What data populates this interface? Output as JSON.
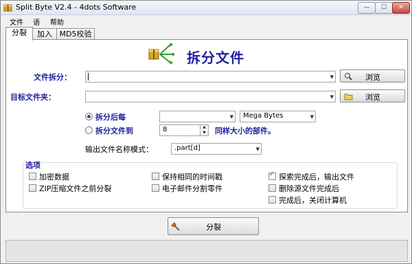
{
  "window": {
    "title": "Split Byte V2.4 - 4dots Software",
    "min_glyph": "—",
    "max_glyph": "☐",
    "close_glyph": "✕",
    "close_color": "#c9463d"
  },
  "menu": [
    "文件",
    "语",
    "帮助"
  ],
  "tabs": [
    "分裂",
    "加入",
    "MD5校验"
  ],
  "main": {
    "heading": "拆分文件",
    "file_label": "文件拆分：",
    "file_value": "",
    "browse_label_1": "浏览",
    "target_label": "目标文件夹：",
    "target_value": "",
    "browse_label_2": "浏览",
    "split_each_label": "拆分后每",
    "split_each_value": "",
    "unit_value": "Mega Bytes",
    "split_into_label": "拆分文件到",
    "split_into_value": "8",
    "same_size_label": "同样大小的部件。",
    "output_mode_label": "输出文件名称模式：",
    "output_mode_value": ".part[d]",
    "split_mode": "size"
  },
  "options": {
    "title": "选项",
    "items": [
      {
        "label": "加密数据",
        "checked": false
      },
      {
        "label": "ZIP压缩文件之前分裂",
        "checked": false
      },
      {
        "label": "保持相同的时间戳",
        "checked": false
      },
      {
        "label": "电子邮件分割零件",
        "checked": false
      },
      {
        "label": "探索完成后，输出文件",
        "checked": true
      },
      {
        "label": "删除源文件完成后",
        "checked": false
      },
      {
        "label": "完成后，关闭计算机",
        "checked": false
      }
    ]
  },
  "action": {
    "split_button": "分裂"
  },
  "icons": {
    "app": "package-icon",
    "heading": "split-package-icon",
    "browse_file": "magnifier-icon",
    "browse_folder": "folder-icon",
    "split_action": "axe-icon"
  }
}
